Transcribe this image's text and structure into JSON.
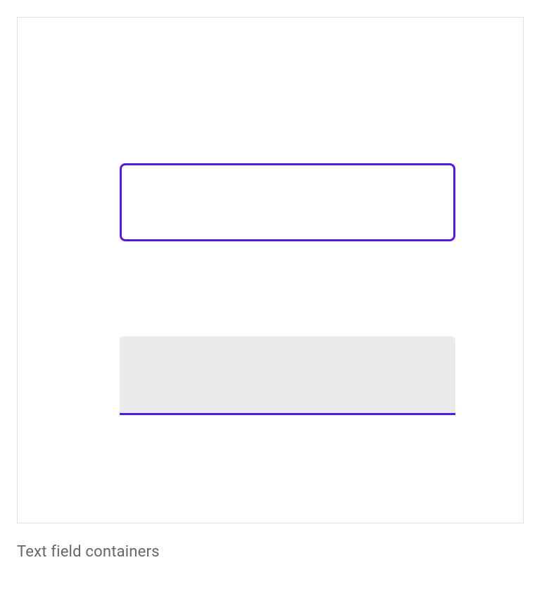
{
  "figure": {
    "caption": "Text field containers",
    "colors": {
      "accent": "#5619e0",
      "fill": "#ebebeb",
      "frame_border": "#e0e0e0",
      "caption_text": "#666666"
    },
    "fields": {
      "outlined": {
        "type": "outlined",
        "value": ""
      },
      "filled": {
        "type": "filled",
        "value": ""
      }
    }
  }
}
